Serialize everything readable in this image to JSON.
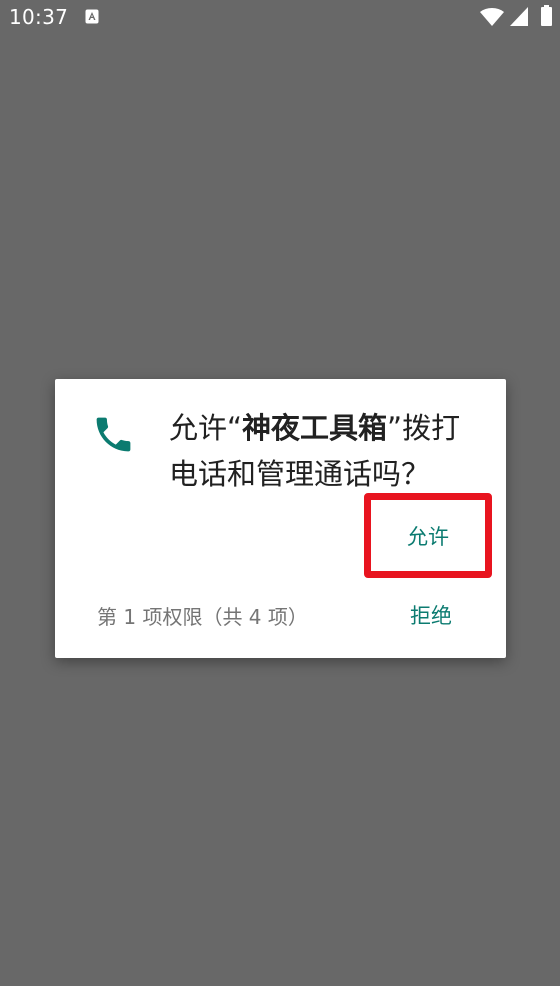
{
  "status_bar": {
    "time": "10:37",
    "icons": [
      "text-a-icon",
      "wifi-icon",
      "signal-icon",
      "battery-icon"
    ]
  },
  "dialog": {
    "icon": "phone-icon",
    "message_prefix": "允许“",
    "app_name": "神夜工具箱",
    "message_suffix": "”拨打电话和管理通话吗？",
    "allow_label": "允许",
    "deny_label": "拒绝",
    "permission_count": "第 1 项权限（共 4 项）"
  },
  "colors": {
    "background": "#686868",
    "accent": "#0b7b70",
    "highlight": "#e8141f"
  }
}
